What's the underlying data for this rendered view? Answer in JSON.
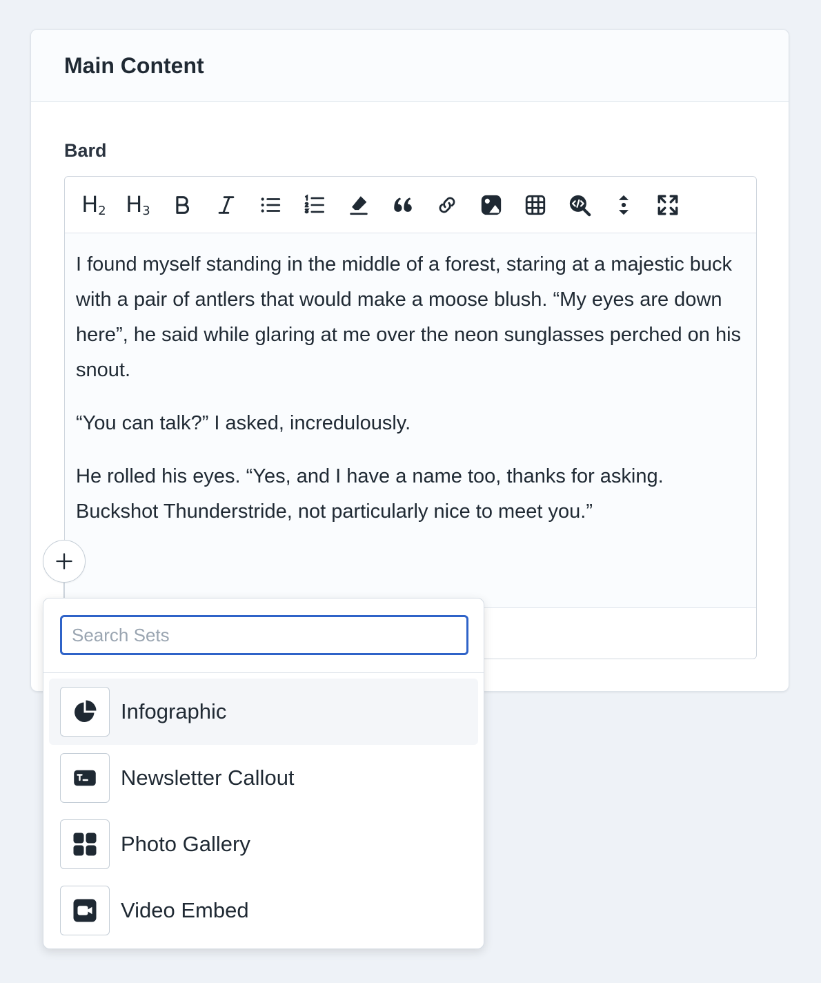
{
  "card": {
    "title": "Main Content"
  },
  "field": {
    "label": "Bard"
  },
  "toolbar": {
    "buttons": [
      {
        "name": "heading-2",
        "text": "H",
        "sub": "2"
      },
      {
        "name": "heading-3",
        "text": "H",
        "sub": "3"
      },
      {
        "name": "bold"
      },
      {
        "name": "italic"
      },
      {
        "name": "unordered-list"
      },
      {
        "name": "ordered-list"
      },
      {
        "name": "remove-format"
      },
      {
        "name": "quote"
      },
      {
        "name": "link"
      },
      {
        "name": "image"
      },
      {
        "name": "table"
      },
      {
        "name": "code-search"
      },
      {
        "name": "expand-vertical"
      },
      {
        "name": "fullscreen"
      }
    ]
  },
  "editor": {
    "paragraphs": [
      "I found myself standing in the middle of a forest, staring at a majestic buck with a pair of antlers that would make a moose blush. “My eyes are down here”, he said while glaring at me over the neon sunglasses perched on his snout.",
      "“You can talk?” I asked, incredulously.",
      "He rolled his eyes. “Yes, and I have a name too, thanks for asking. Buckshot Thunderstride, not particularly nice to meet you.”"
    ]
  },
  "sets_popover": {
    "search_placeholder": "Search Sets",
    "search_value": "",
    "items": [
      {
        "label": "Infographic",
        "icon": "pie-chart-icon",
        "active": true
      },
      {
        "label": "Newsletter Callout",
        "icon": "terminal-icon",
        "active": false
      },
      {
        "label": "Photo Gallery",
        "icon": "grid-icon",
        "active": false
      },
      {
        "label": "Video Embed",
        "icon": "video-icon",
        "active": false
      }
    ]
  },
  "colors": {
    "accent": "#2f63c8",
    "text": "#1f2933",
    "border": "#dde3ea",
    "background": "#eef2f7"
  }
}
